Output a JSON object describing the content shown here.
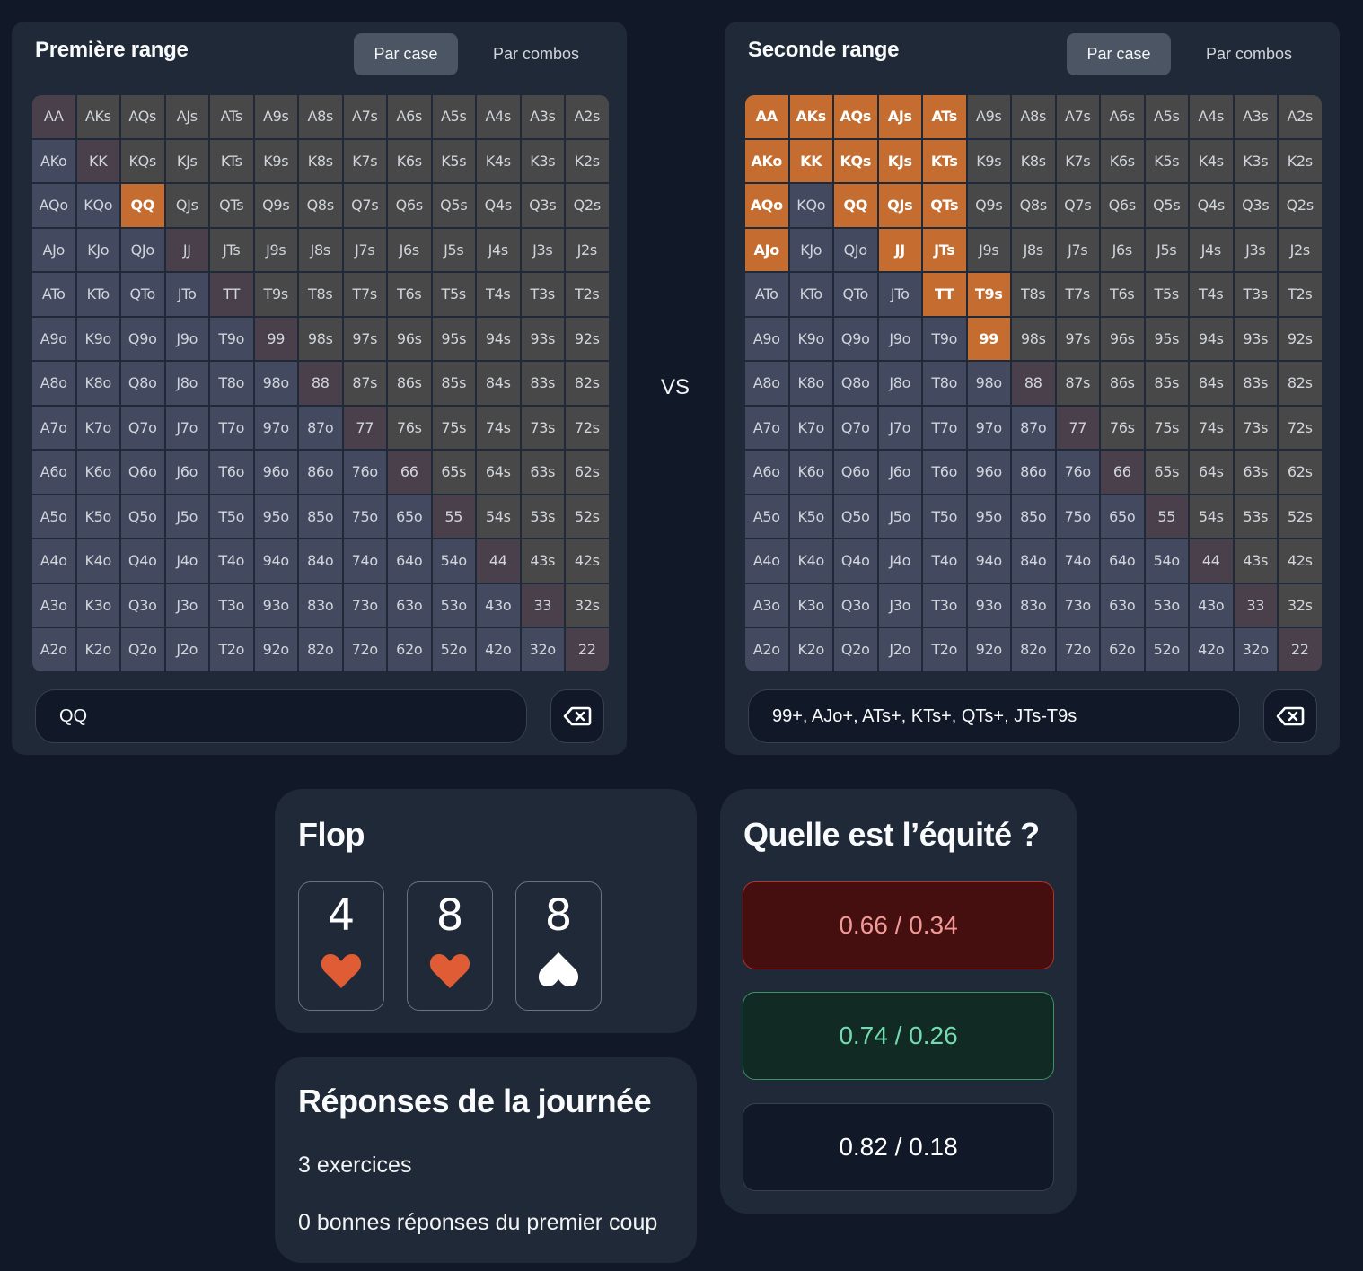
{
  "ranges": [
    {
      "title": "Première range",
      "modes": {
        "active": "Par case",
        "inactive": "Par combos"
      },
      "input_value": "QQ",
      "selected": [
        "QQ"
      ]
    },
    {
      "title": "Seconde range",
      "modes": {
        "active": "Par case",
        "inactive": "Par combos"
      },
      "input_value": "99+, AJo+, ATs+, KTs+, QTs+, JTs-T9s",
      "selected": [
        "AA",
        "AKs",
        "AQs",
        "AJs",
        "ATs",
        "AKo",
        "KK",
        "KQs",
        "KJs",
        "KTs",
        "AQo",
        "QQ",
        "QJs",
        "QTs",
        "AJo",
        "JJ",
        "JTs",
        "TT",
        "T9s",
        "99"
      ]
    }
  ],
  "ranks": [
    "A",
    "K",
    "Q",
    "J",
    "T",
    "9",
    "8",
    "7",
    "6",
    "5",
    "4",
    "3",
    "2"
  ],
  "vs_label": "VS",
  "icons": {
    "clear": "backspace-x-icon",
    "heart": "heart-icon",
    "spade": "spade-icon"
  },
  "colors": {
    "selected": "#c56d30",
    "pair": "#4a404c",
    "suited": "#484848",
    "offsuit": "#434a60",
    "heart": "#e05c34",
    "spade": "#ffffff"
  },
  "flop": {
    "title": "Flop",
    "cards": [
      {
        "rank": "4",
        "suit": "heart"
      },
      {
        "rank": "8",
        "suit": "heart"
      },
      {
        "rank": "8",
        "suit": "spade"
      }
    ]
  },
  "responses": {
    "title": "Réponses de la journée",
    "exercises": "3 exercices",
    "first_try": "0 bonnes réponses du premier coup"
  },
  "equity": {
    "title": "Quelle est l’équité ?",
    "options": [
      {
        "label": "0.66 / 0.34",
        "state": "wrong"
      },
      {
        "label": "0.74 / 0.26",
        "state": "correct"
      },
      {
        "label": "0.82 / 0.18",
        "state": "neutral"
      }
    ]
  }
}
